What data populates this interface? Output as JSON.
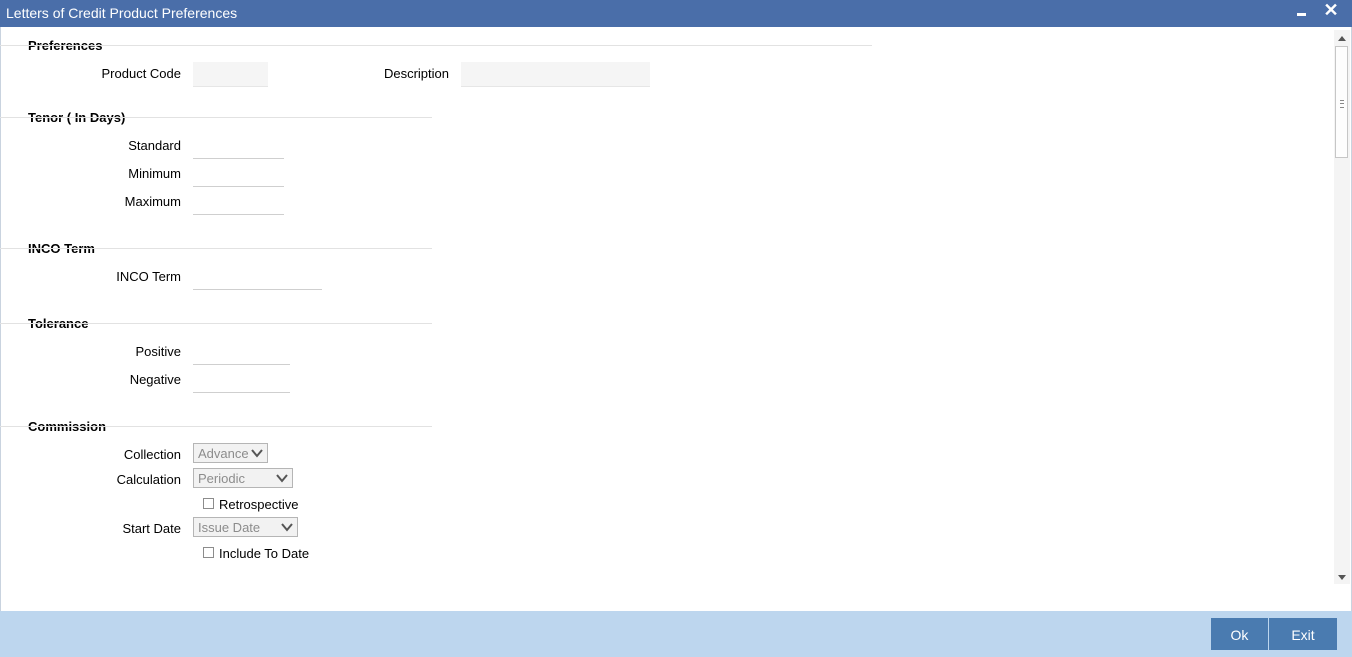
{
  "window": {
    "title": "Letters of Credit Product Preferences"
  },
  "preferences": {
    "heading": "Preferences",
    "product_code_label": "Product Code",
    "product_code_value": "",
    "description_label": "Description",
    "description_value": ""
  },
  "tenor": {
    "heading": "Tenor ( In Days)",
    "standard_label": "Standard",
    "minimum_label": "Minimum",
    "maximum_label": "Maximum"
  },
  "inco": {
    "heading": "INCO Term",
    "inco_term_label": "INCO Term"
  },
  "tolerance": {
    "heading": "Tolerance",
    "positive_label": "Positive",
    "negative_label": "Negative"
  },
  "commission": {
    "heading": "Commission",
    "collection_label": "Collection",
    "collection_value": "Advance",
    "calculation_label": "Calculation",
    "calculation_value": "Periodic",
    "retrospective_label": "Retrospective",
    "retrospective_checked": false,
    "start_date_label": "Start Date",
    "start_date_value": "Issue Date",
    "include_to_date_label": "Include To Date",
    "include_to_date_checked": false
  },
  "footer": {
    "ok_label": "Ok",
    "exit_label": "Exit"
  },
  "colors": {
    "titlebar": "#4a6ea9",
    "footer": "#bdd6ee",
    "button": "#4a7bb0"
  },
  "icons": {
    "minimize": "minimize-icon",
    "close": "close-icon",
    "chevron": "chevron-down-icon"
  }
}
